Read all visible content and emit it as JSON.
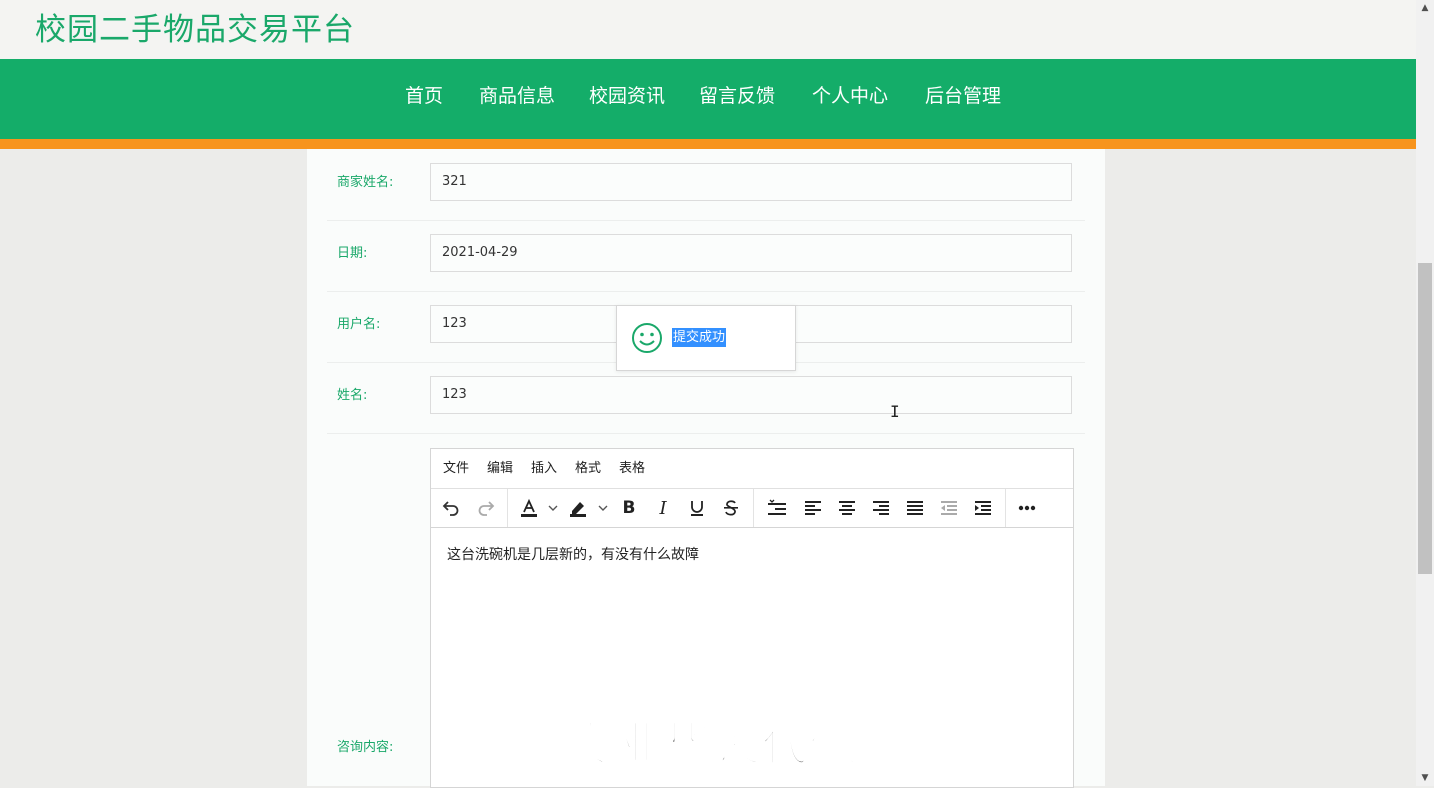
{
  "site": {
    "title": "校园二手物品交易平台"
  },
  "nav": {
    "items": [
      "首页",
      "商品信息",
      "校园资讯",
      "留言反馈",
      "个人中心",
      "后台管理"
    ]
  },
  "form": {
    "fields": [
      {
        "label": "商家姓名:",
        "value": "321"
      },
      {
        "label": "日期:",
        "value": "2021-04-29"
      },
      {
        "label": "用户名:",
        "value": "123"
      },
      {
        "label": "姓名:",
        "value": "123"
      }
    ],
    "consult_label": "咨询内容:"
  },
  "editor": {
    "menus": [
      "文件",
      "编辑",
      "插入",
      "格式",
      "表格"
    ],
    "toolbar_icons": [
      "undo-icon",
      "redo-icon",
      "text-color-icon",
      "highlight-color-icon",
      "bold-icon",
      "italic-icon",
      "underline-icon",
      "strikethrough-icon",
      "line-height-icon",
      "align-left-icon",
      "align-center-icon",
      "align-right-icon",
      "align-justify-icon",
      "outdent-icon",
      "indent-icon",
      "more-icon"
    ],
    "content": "这台洗碗机是几层新的，有没有什么故障"
  },
  "toast": {
    "message": "提交成功",
    "icon": "smile-icon"
  },
  "watermark": "专业毕设代做",
  "colors": {
    "brand": "#14ad69",
    "accent": "#f7941d",
    "selection": "#3390ff"
  }
}
